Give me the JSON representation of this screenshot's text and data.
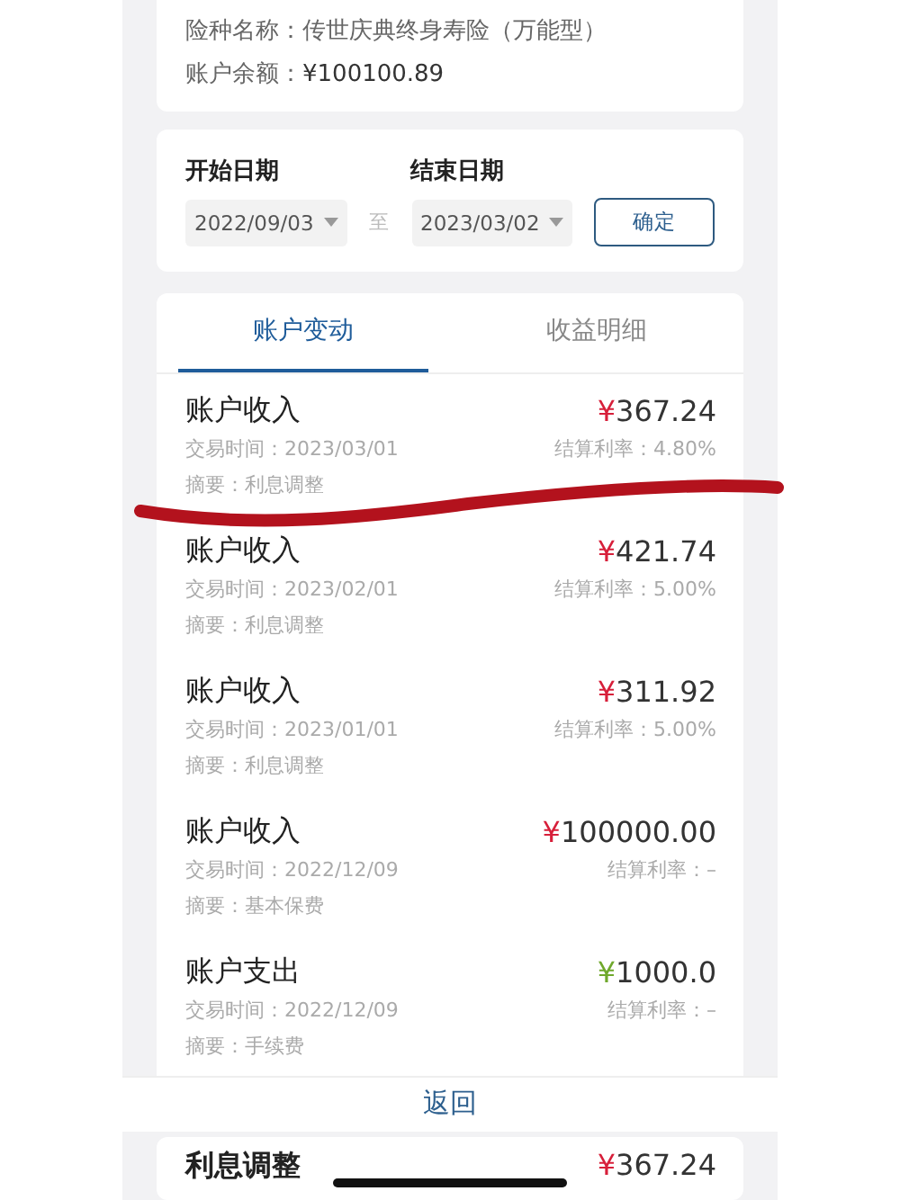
{
  "policy": {
    "name_label": "险种名称：",
    "name": "传世庆典终身寿险（万能型）",
    "balance_label": "账户余额：",
    "balance": "¥100100.89"
  },
  "date_filter": {
    "start_label": "开始日期",
    "start": "2022/09/03",
    "separator": "至",
    "end_label": "结束日期",
    "end": "2023/03/02",
    "confirm": "确定"
  },
  "tabs": [
    {
      "label": "账户变动",
      "selected": true
    },
    {
      "label": "收益明细",
      "selected": false
    }
  ],
  "transactions": [
    {
      "kind": "income",
      "title": "账户收入",
      "currency": "¥",
      "amount": "367.24",
      "time": "交易时间：2023/03/01",
      "rate": "结算利率：4.80%",
      "summary": "摘要：利息调整"
    },
    {
      "kind": "income",
      "title": "账户收入",
      "currency": "¥",
      "amount": "421.74",
      "time": "交易时间：2023/02/01",
      "rate": "结算利率：5.00%",
      "summary": "摘要：利息调整"
    },
    {
      "kind": "income",
      "title": "账户收入",
      "currency": "¥",
      "amount": "311.92",
      "time": "交易时间：2023/01/01",
      "rate": "结算利率：5.00%",
      "summary": "摘要：利息调整"
    },
    {
      "kind": "income",
      "title": "账户收入",
      "currency": "¥",
      "amount": "100000.00",
      "time": "交易时间：2022/12/09",
      "rate": "结算利率：–",
      "summary": "摘要：基本保费"
    },
    {
      "kind": "expense",
      "title": "账户支出",
      "currency": "¥",
      "amount": "1000.0",
      "time": "交易时间：2022/12/09",
      "rate": "结算利率：–",
      "summary": "摘要：手续费"
    }
  ],
  "back_button": "返回",
  "next_screen": {
    "title": "利息调整",
    "currency": "¥",
    "amount": "367.24"
  }
}
